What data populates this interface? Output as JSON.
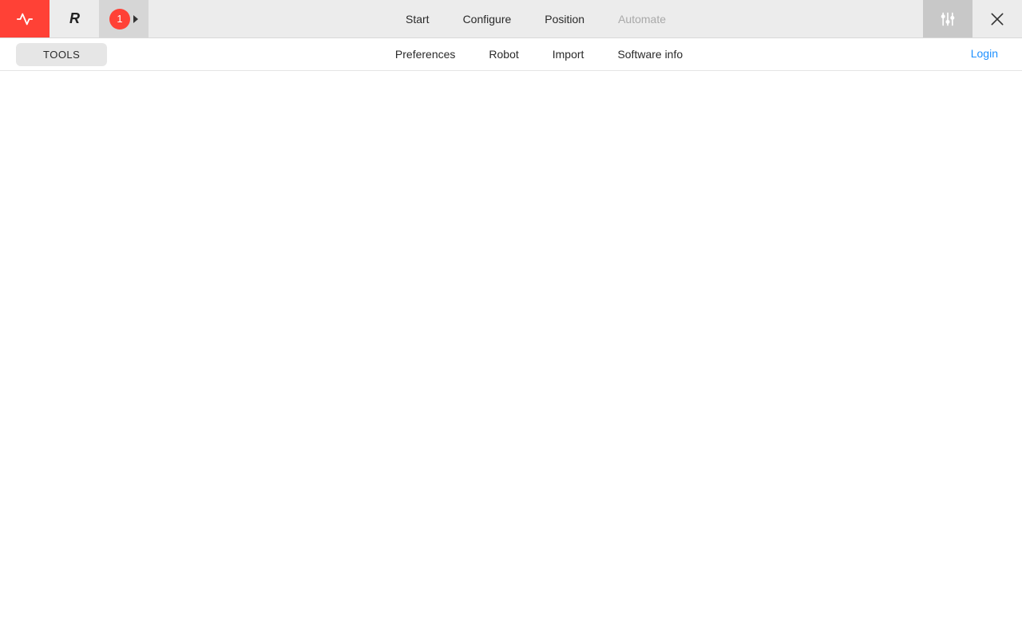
{
  "header": {
    "brand_text": "R",
    "badge_count": "1",
    "nav": [
      {
        "label": "Start",
        "disabled": false
      },
      {
        "label": "Configure",
        "disabled": false
      },
      {
        "label": "Position",
        "disabled": false
      },
      {
        "label": "Automate",
        "disabled": true
      }
    ]
  },
  "subbar": {
    "tools_label": "TOOLS",
    "items": [
      {
        "label": "Preferences"
      },
      {
        "label": "Robot"
      },
      {
        "label": "Import"
      },
      {
        "label": "Software info"
      }
    ],
    "login_label": "Login"
  },
  "colors": {
    "accent_red": "#ff4136",
    "link_blue": "#1e90ff",
    "toolbar_bg": "#ececec"
  }
}
